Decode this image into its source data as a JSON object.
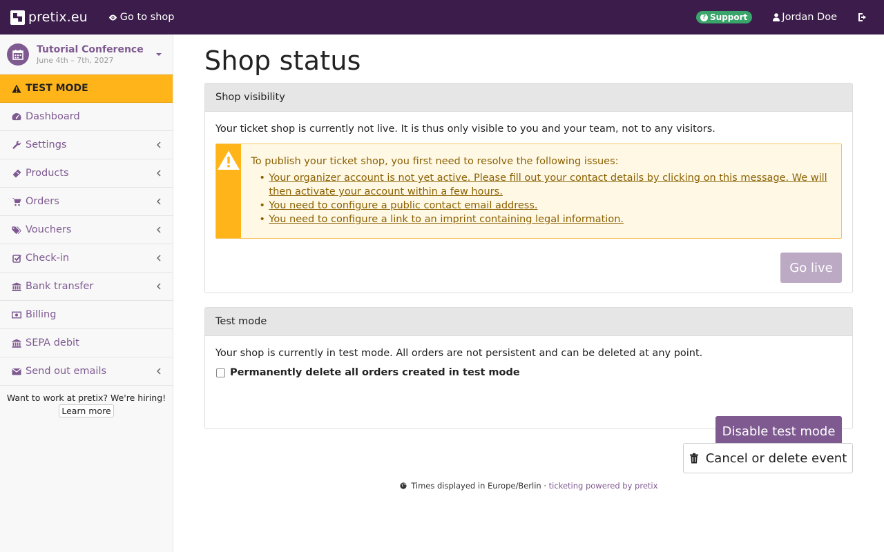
{
  "topbar": {
    "brand": "pretix.eu",
    "go_to_shop": "Go to shop",
    "support": "Support",
    "user": "Jordan Doe"
  },
  "event": {
    "title": "Tutorial Conference",
    "date": "June 4th – 7th, 2027"
  },
  "sidebar": {
    "test_mode": "TEST MODE",
    "items": [
      {
        "label": "Dashboard",
        "icon": "dashboard-icon",
        "has_submenu": false
      },
      {
        "label": "Settings",
        "icon": "wrench-icon",
        "has_submenu": true
      },
      {
        "label": "Products",
        "icon": "ticket-icon",
        "has_submenu": true
      },
      {
        "label": "Orders",
        "icon": "cart-icon",
        "has_submenu": true
      },
      {
        "label": "Vouchers",
        "icon": "tags-icon",
        "has_submenu": true
      },
      {
        "label": "Check-in",
        "icon": "check-square-icon",
        "has_submenu": true
      },
      {
        "label": "Bank transfer",
        "icon": "bank-icon",
        "has_submenu": true
      },
      {
        "label": "Billing",
        "icon": "money-icon",
        "has_submenu": false
      },
      {
        "label": "SEPA debit",
        "icon": "bank-icon",
        "has_submenu": false
      },
      {
        "label": "Send out emails",
        "icon": "envelope-icon",
        "has_submenu": true
      }
    ],
    "hiring_text": "Want to work at pretix? We're hiring!",
    "learn_more": "Learn more"
  },
  "main": {
    "title": "Shop status",
    "visibility": {
      "heading": "Shop visibility",
      "text": "Your ticket shop is currently not live. It is thus only visible to you and your team, not to any visitors.",
      "alert_intro": "To publish your ticket shop, you first need to resolve the following issues:",
      "issues": [
        "Your organizer account is not yet active. Please fill out your contact details by clicking on this message. We will then activate your account within a few hours.",
        "You need to configure a public contact email address.",
        "You need to configure a link to an imprint containing legal information."
      ],
      "go_live": "Go live"
    },
    "testmode": {
      "heading": "Test mode",
      "text": "Your shop is currently in test mode. All orders are not persistent and can be deleted at any point.",
      "checkbox_label": "Permanently delete all orders created in test mode",
      "disable_button": "Disable test mode"
    },
    "cancel_button": "Cancel or delete event"
  },
  "footer": {
    "timezone": "Times displayed in Europe/Berlin ·",
    "powered": "ticketing powered by pretix"
  },
  "colors": {
    "topbar": "#3b1c4a",
    "primary": "#7f5a91",
    "warning": "#ffb419",
    "success": "#3aa56b"
  }
}
